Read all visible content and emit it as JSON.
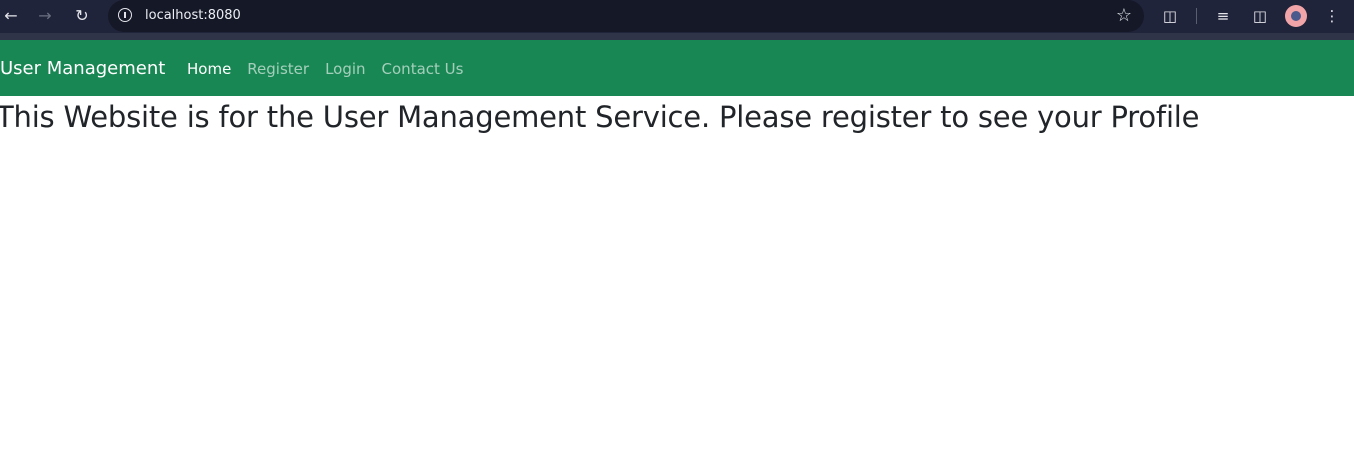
{
  "browser": {
    "url": "localhost:8080",
    "icons": {
      "back": "back-arrow-icon",
      "forward": "forward-arrow-icon",
      "reload": "reload-icon",
      "site_info": "info-icon",
      "bookmark": "star-icon",
      "extensions": "puzzle-icon",
      "media": "media-queue-icon",
      "side_panel": "side-panel-icon",
      "menu": "kebab-menu-icon"
    }
  },
  "navbar": {
    "brand": "User Management",
    "links": [
      {
        "label": "Home",
        "active": true
      },
      {
        "label": "Register",
        "active": false
      },
      {
        "label": "Login",
        "active": false
      },
      {
        "label": "Contact Us",
        "active": false
      }
    ],
    "color": "#198754"
  },
  "main": {
    "heading": "This Website is for the User Management Service. Please register to see your Profile"
  }
}
